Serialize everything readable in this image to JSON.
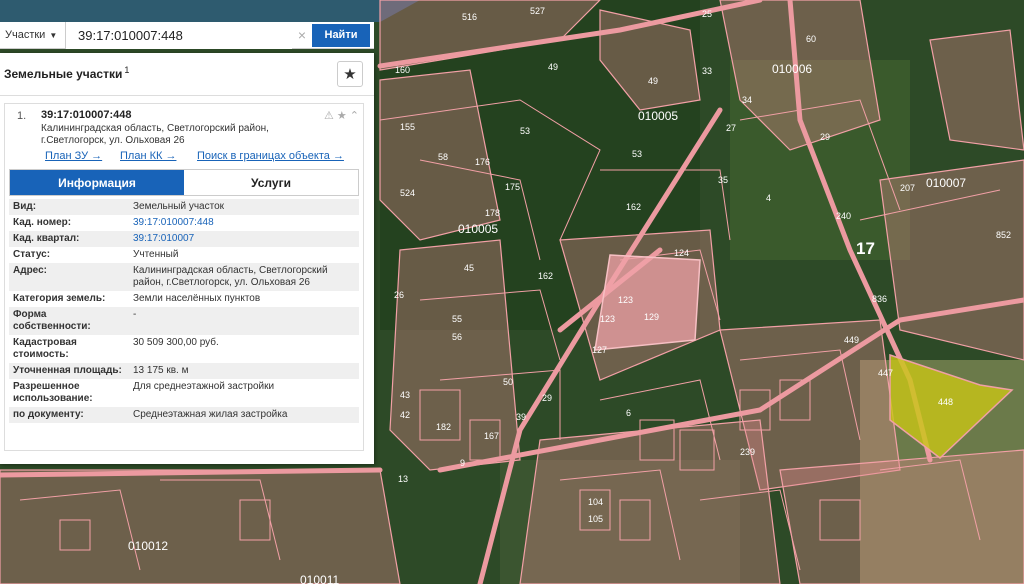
{
  "search": {
    "type_label": "Участки",
    "query": "39:17:010007:448",
    "find_label": "Найти"
  },
  "panel": {
    "title": "Земельные участки",
    "count": "1"
  },
  "result": {
    "index": "1.",
    "cad_number": "39:17:010007:448",
    "address": "Калининградская область, Светлогорский район, г.Светлогорск, ул. Ольховая 26",
    "links": {
      "plan_zu": "План ЗУ →",
      "plan_kk": "План КК →",
      "search_in_bounds": "Поиск в границах объекта →"
    },
    "tabs": {
      "info": "Информация",
      "services": "Услуги"
    },
    "rows": [
      {
        "key": "Вид:",
        "value": "Земельный участок"
      },
      {
        "key": "Кад. номер:",
        "value": "39:17:010007:448"
      },
      {
        "key": "Кад. квартал:",
        "value": "39:17:010007"
      },
      {
        "key": "Статус:",
        "value": "Учтенный"
      },
      {
        "key": "Адрес:",
        "value": "Калининградская область, Светлогорский район, г.Светлогорск, ул. Ольховая 26"
      },
      {
        "key": "Категория земель:",
        "value": "Земли населённых пунктов"
      },
      {
        "key": "Форма собственности:",
        "value": "-"
      },
      {
        "key": "Кадастровая стоимость:",
        "value": "30 509 300,00 руб."
      },
      {
        "key": "Уточненная площадь:",
        "value": "13 175 кв. м"
      },
      {
        "key": "Разрешенное использование:",
        "value": "Для среднеэтажной застройки"
      },
      {
        "key": "по документу:",
        "value": "Среднеэтажная жилая застройка"
      }
    ]
  },
  "map": {
    "parcel_labels": [
      "516",
      "527",
      "25",
      "60",
      "49",
      "49",
      "33",
      "34",
      "010006",
      "160",
      "53",
      "010005",
      "27",
      "29",
      "155",
      "58",
      "176",
      "175",
      "53",
      "524",
      "162",
      "178",
      "010005",
      "35",
      "207",
      "010007",
      "240",
      "4",
      "17",
      "852",
      "45",
      "124",
      "162",
      "26",
      "123",
      "129",
      "123",
      "127",
      "836",
      "55",
      "56",
      "449",
      "447",
      "448",
      "182",
      "167",
      "50",
      "29",
      "39",
      "010006",
      "6",
      "239",
      "010012",
      "104",
      "105",
      "010011",
      "43",
      "42",
      "9",
      "13"
    ],
    "colors": {
      "parcel_fill": "#e58a8f",
      "highlight": "#d4d418",
      "forest": "#2d4a27"
    }
  }
}
